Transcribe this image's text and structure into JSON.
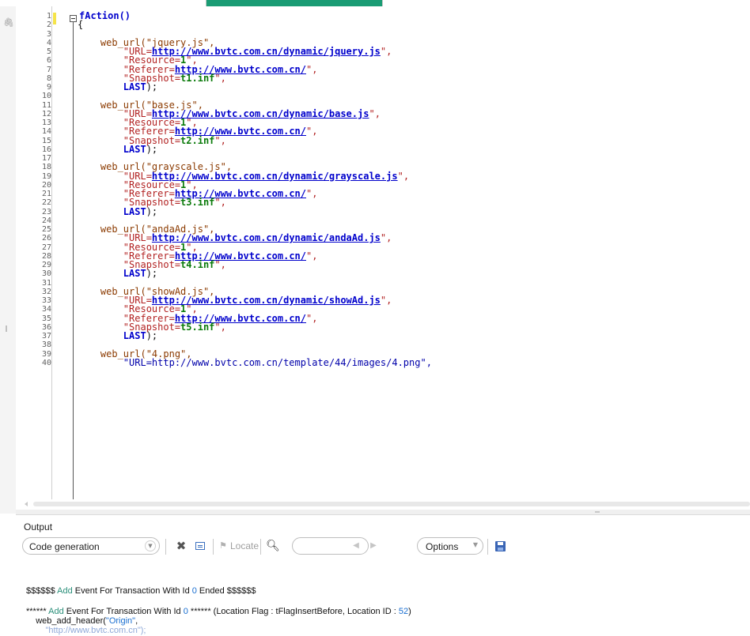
{
  "top_bar": {
    "active_tab_color": "#1a9c74"
  },
  "editor": {
    "margin_icon": "pin-icon",
    "lines": [
      {
        "n": "1",
        "tokens": [
          {
            "t": "fAction()",
            "c": "kwfunc"
          }
        ]
      },
      {
        "n": "2",
        "tokens": [
          {
            "t": "{",
            "c": "txt"
          }
        ]
      },
      {
        "n": "3",
        "tokens": []
      },
      {
        "n": "4",
        "tokens": [
          {
            "t": "    ",
            "c": "txt"
          },
          {
            "t": "web_url(\"jquery.js\",",
            "c": "fn"
          }
        ]
      },
      {
        "n": "5",
        "tokens": [
          {
            "t": "        ",
            "c": "txt"
          },
          {
            "t": "\"URL=",
            "c": "str"
          },
          {
            "t": "http://www.bvtc.com.cn/dynamic/jquery.js",
            "c": "url"
          },
          {
            "t": "\",",
            "c": "str"
          }
        ]
      },
      {
        "n": "6",
        "tokens": [
          {
            "t": "        ",
            "c": "txt"
          },
          {
            "t": "\"Resource=",
            "c": "str"
          },
          {
            "t": "1",
            "c": "num"
          },
          {
            "t": "\",",
            "c": "str"
          }
        ]
      },
      {
        "n": "7",
        "tokens": [
          {
            "t": "        ",
            "c": "txt"
          },
          {
            "t": "\"Referer=",
            "c": "str"
          },
          {
            "t": "http://www.bvtc.com.cn/",
            "c": "url"
          },
          {
            "t": "\",",
            "c": "str"
          }
        ]
      },
      {
        "n": "8",
        "tokens": [
          {
            "t": "        ",
            "c": "txt"
          },
          {
            "t": "\"Snapshot=",
            "c": "str"
          },
          {
            "t": "t1.inf",
            "c": "num"
          },
          {
            "t": "\",",
            "c": "str"
          }
        ]
      },
      {
        "n": "9",
        "tokens": [
          {
            "t": "        ",
            "c": "txt"
          },
          {
            "t": "LAST",
            "c": "kw"
          },
          {
            "t": ");",
            "c": "txt"
          }
        ]
      },
      {
        "n": "10",
        "tokens": []
      },
      {
        "n": "11",
        "tokens": [
          {
            "t": "    ",
            "c": "txt"
          },
          {
            "t": "web_url(\"base.js\",",
            "c": "fn"
          }
        ]
      },
      {
        "n": "12",
        "tokens": [
          {
            "t": "        ",
            "c": "txt"
          },
          {
            "t": "\"URL=",
            "c": "str"
          },
          {
            "t": "http://www.bvtc.com.cn/dynamic/base.js",
            "c": "url"
          },
          {
            "t": "\",",
            "c": "str"
          }
        ]
      },
      {
        "n": "13",
        "tokens": [
          {
            "t": "        ",
            "c": "txt"
          },
          {
            "t": "\"Resource=",
            "c": "str"
          },
          {
            "t": "1",
            "c": "num"
          },
          {
            "t": "\",",
            "c": "str"
          }
        ]
      },
      {
        "n": "14",
        "tokens": [
          {
            "t": "        ",
            "c": "txt"
          },
          {
            "t": "\"Referer=",
            "c": "str"
          },
          {
            "t": "http://www.bvtc.com.cn/",
            "c": "url"
          },
          {
            "t": "\",",
            "c": "str"
          }
        ]
      },
      {
        "n": "15",
        "tokens": [
          {
            "t": "        ",
            "c": "txt"
          },
          {
            "t": "\"Snapshot=",
            "c": "str"
          },
          {
            "t": "t2.inf",
            "c": "num"
          },
          {
            "t": "\",",
            "c": "str"
          }
        ]
      },
      {
        "n": "16",
        "tokens": [
          {
            "t": "        ",
            "c": "txt"
          },
          {
            "t": "LAST",
            "c": "kw"
          },
          {
            "t": ");",
            "c": "txt"
          }
        ]
      },
      {
        "n": "17",
        "tokens": []
      },
      {
        "n": "18",
        "tokens": [
          {
            "t": "    ",
            "c": "txt"
          },
          {
            "t": "web_url(\"grayscale.js\",",
            "c": "fn"
          }
        ]
      },
      {
        "n": "19",
        "tokens": [
          {
            "t": "        ",
            "c": "txt"
          },
          {
            "t": "\"URL=",
            "c": "str"
          },
          {
            "t": "http://www.bvtc.com.cn/dynamic/grayscale.js",
            "c": "url"
          },
          {
            "t": "\",",
            "c": "str"
          }
        ]
      },
      {
        "n": "20",
        "tokens": [
          {
            "t": "        ",
            "c": "txt"
          },
          {
            "t": "\"Resource=",
            "c": "str"
          },
          {
            "t": "1",
            "c": "num"
          },
          {
            "t": "\",",
            "c": "str"
          }
        ]
      },
      {
        "n": "21",
        "tokens": [
          {
            "t": "        ",
            "c": "txt"
          },
          {
            "t": "\"Referer=",
            "c": "str"
          },
          {
            "t": "http://www.bvtc.com.cn/",
            "c": "url"
          },
          {
            "t": "\",",
            "c": "str"
          }
        ]
      },
      {
        "n": "22",
        "tokens": [
          {
            "t": "        ",
            "c": "txt"
          },
          {
            "t": "\"Snapshot=",
            "c": "str"
          },
          {
            "t": "t3.inf",
            "c": "num"
          },
          {
            "t": "\",",
            "c": "str"
          }
        ]
      },
      {
        "n": "23",
        "tokens": [
          {
            "t": "        ",
            "c": "txt"
          },
          {
            "t": "LAST",
            "c": "kw"
          },
          {
            "t": ");",
            "c": "txt"
          }
        ]
      },
      {
        "n": "24",
        "tokens": []
      },
      {
        "n": "25",
        "tokens": [
          {
            "t": "    ",
            "c": "txt"
          },
          {
            "t": "web_url(\"andaAd.js\",",
            "c": "fn"
          }
        ]
      },
      {
        "n": "26",
        "tokens": [
          {
            "t": "        ",
            "c": "txt"
          },
          {
            "t": "\"URL=",
            "c": "str"
          },
          {
            "t": "http://www.bvtc.com.cn/dynamic/andaAd.js",
            "c": "url"
          },
          {
            "t": "\",",
            "c": "str"
          }
        ]
      },
      {
        "n": "27",
        "tokens": [
          {
            "t": "        ",
            "c": "txt"
          },
          {
            "t": "\"Resource=",
            "c": "str"
          },
          {
            "t": "1",
            "c": "num"
          },
          {
            "t": "\",",
            "c": "str"
          }
        ]
      },
      {
        "n": "28",
        "tokens": [
          {
            "t": "        ",
            "c": "txt"
          },
          {
            "t": "\"Referer=",
            "c": "str"
          },
          {
            "t": "http://www.bvtc.com.cn/",
            "c": "url"
          },
          {
            "t": "\",",
            "c": "str"
          }
        ]
      },
      {
        "n": "29",
        "tokens": [
          {
            "t": "        ",
            "c": "txt"
          },
          {
            "t": "\"Snapshot=",
            "c": "str"
          },
          {
            "t": "t4.inf",
            "c": "num"
          },
          {
            "t": "\",",
            "c": "str"
          }
        ]
      },
      {
        "n": "30",
        "tokens": [
          {
            "t": "        ",
            "c": "txt"
          },
          {
            "t": "LAST",
            "c": "kw"
          },
          {
            "t": ");",
            "c": "txt"
          }
        ]
      },
      {
        "n": "31",
        "tokens": []
      },
      {
        "n": "32",
        "tokens": [
          {
            "t": "    ",
            "c": "txt"
          },
          {
            "t": "web_url(\"showAd.js\",",
            "c": "fn"
          }
        ]
      },
      {
        "n": "33",
        "tokens": [
          {
            "t": "        ",
            "c": "txt"
          },
          {
            "t": "\"URL=",
            "c": "str"
          },
          {
            "t": "http://www.bvtc.com.cn/dynamic/showAd.js",
            "c": "url"
          },
          {
            "t": "\",",
            "c": "str"
          }
        ]
      },
      {
        "n": "34",
        "tokens": [
          {
            "t": "        ",
            "c": "txt"
          },
          {
            "t": "\"Resource=",
            "c": "str"
          },
          {
            "t": "1",
            "c": "num"
          },
          {
            "t": "\",",
            "c": "str"
          }
        ]
      },
      {
        "n": "35",
        "tokens": [
          {
            "t": "        ",
            "c": "txt"
          },
          {
            "t": "\"Referer=",
            "c": "str"
          },
          {
            "t": "http://www.bvtc.com.cn/",
            "c": "url"
          },
          {
            "t": "\",",
            "c": "str"
          }
        ]
      },
      {
        "n": "36",
        "tokens": [
          {
            "t": "        ",
            "c": "txt"
          },
          {
            "t": "\"Snapshot=",
            "c": "str"
          },
          {
            "t": "t5.inf",
            "c": "num"
          },
          {
            "t": "\",",
            "c": "str"
          }
        ]
      },
      {
        "n": "37",
        "tokens": [
          {
            "t": "        ",
            "c": "txt"
          },
          {
            "t": "LAST",
            "c": "kw"
          },
          {
            "t": ");",
            "c": "txt"
          }
        ]
      },
      {
        "n": "38",
        "tokens": []
      },
      {
        "n": "39",
        "tokens": [
          {
            "t": "    ",
            "c": "txt"
          },
          {
            "t": "web_url(\"4.png\",",
            "c": "fn"
          }
        ]
      },
      {
        "n": "40",
        "tokens": [
          {
            "t": "        ",
            "c": "txt"
          },
          {
            "t": "\"URL=http://www.bvtc.com.cn/template/44/images/4.png\",",
            "c": "strplain"
          }
        ]
      }
    ]
  },
  "output": {
    "title": "Output",
    "source_combo_value": "Code generation",
    "clear_icon": "x-icon",
    "clear_window_icon": "clear-window-icon",
    "locate_label": "Locate",
    "search_icon": "search-icon",
    "search_value": "",
    "prev_icon": "prev-icon",
    "next_icon": "next-icon",
    "options_label": "Options",
    "save_icon": "save-icon",
    "log": {
      "l1": {
        "a": "$$$$$$ ",
        "b": "Add",
        "c": " Event For Transaction With Id ",
        "d": "0",
        "e": " Ended $$$$$$"
      },
      "l2": {
        "a": "****** ",
        "b": "Add",
        "c": " Event For Transaction With Id ",
        "d": "0",
        "e": " ****** (Location Flag : tFlagInsertBefore, Location ID : ",
        "f": "52",
        "g": ")"
      },
      "l3": {
        "a": "    web_add_header(",
        "b": "\"Origin\"",
        "c": ","
      },
      "l4": {
        "a": "        \"http://www.bvtc.com.cn\");"
      }
    }
  }
}
